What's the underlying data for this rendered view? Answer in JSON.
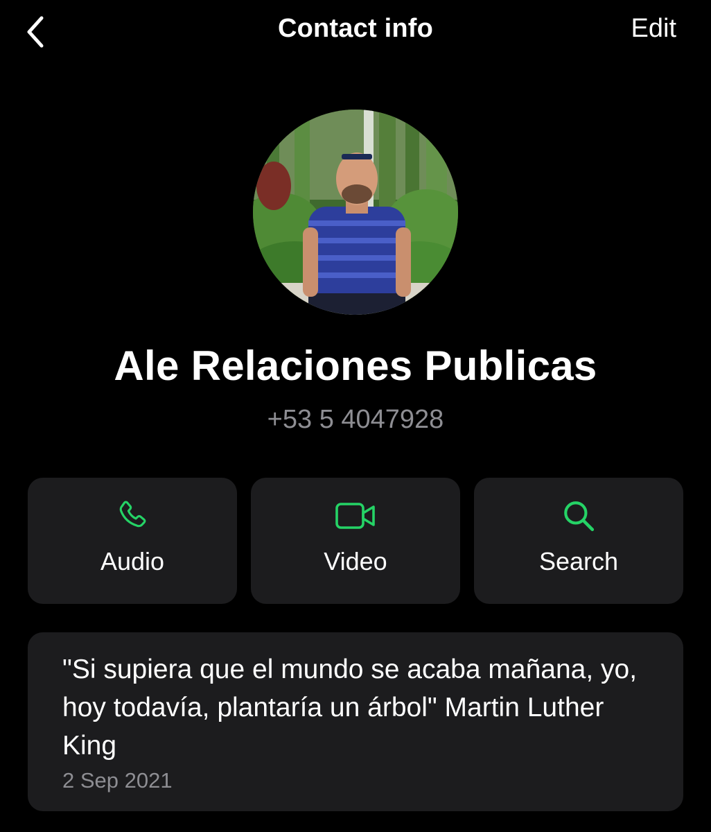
{
  "header": {
    "title": "Contact info",
    "edit_label": "Edit"
  },
  "contact": {
    "name": "Ale Relaciones Publicas",
    "phone": "+53 5 4047928"
  },
  "actions": [
    {
      "label": "Audio",
      "icon": "phone-icon"
    },
    {
      "label": "Video",
      "icon": "video-camera-icon"
    },
    {
      "label": "Search",
      "icon": "search-icon"
    }
  ],
  "about": {
    "text": "\"Si supiera que el mundo se acaba mañana, yo, hoy todavía, plantaría un árbol\" Martin Luther King",
    "date": "2 Sep 2021"
  },
  "colors": {
    "background": "#000000",
    "card": "#1c1c1e",
    "accent": "#25d366",
    "secondary_text": "#8e8e93"
  }
}
